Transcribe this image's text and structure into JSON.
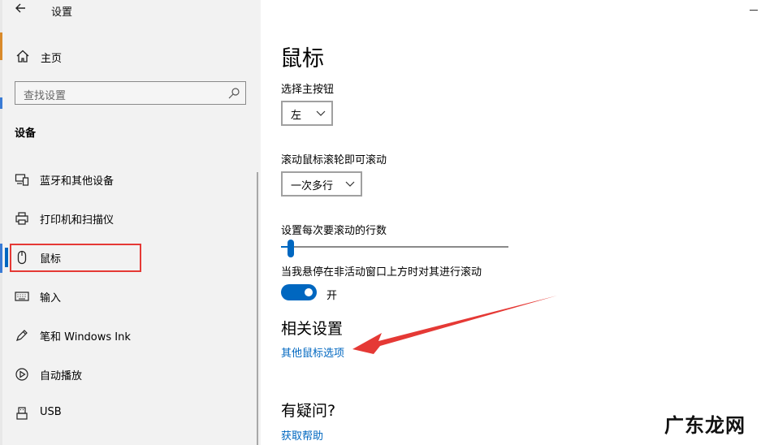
{
  "window": {
    "title": "设置",
    "back_icon": "back-arrow-icon"
  },
  "sidebar": {
    "home_label": "主页",
    "search_placeholder": "查找设置",
    "section_title": "设备",
    "items": [
      {
        "label": "蓝牙和其他设备",
        "icon": "bluetooth-devices-icon",
        "selected": false
      },
      {
        "label": "打印机和扫描仪",
        "icon": "printer-icon",
        "selected": false
      },
      {
        "label": "鼠标",
        "icon": "mouse-icon",
        "selected": true
      },
      {
        "label": "输入",
        "icon": "keyboard-icon",
        "selected": false
      },
      {
        "label": "笔和 Windows Ink",
        "icon": "pen-icon",
        "selected": false
      },
      {
        "label": "自动播放",
        "icon": "autoplay-icon",
        "selected": false
      },
      {
        "label": "USB",
        "icon": "usb-icon",
        "selected": false
      }
    ]
  },
  "main": {
    "title": "鼠标",
    "primary_button": {
      "label": "选择主按钮",
      "value": "左"
    },
    "scroll_mode": {
      "label": "滚动鼠标滚轮即可滚动",
      "value": "一次多行"
    },
    "lines_to_scroll": {
      "label": "设置每次要滚动的行数",
      "value_fraction": 0.03
    },
    "inactive_scroll": {
      "label": "当我悬停在非活动窗口上方时对其进行滚动",
      "state_label": "开",
      "on": true
    },
    "related": {
      "heading": "相关设置",
      "link": "其他鼠标选项"
    },
    "help": {
      "heading": "有疑问?",
      "link": "获取帮助"
    }
  },
  "colors": {
    "accent": "#0067c0",
    "annotation": "#e53935",
    "sidebar_bg": "#f2f2f2"
  },
  "watermark": "广东龙网"
}
